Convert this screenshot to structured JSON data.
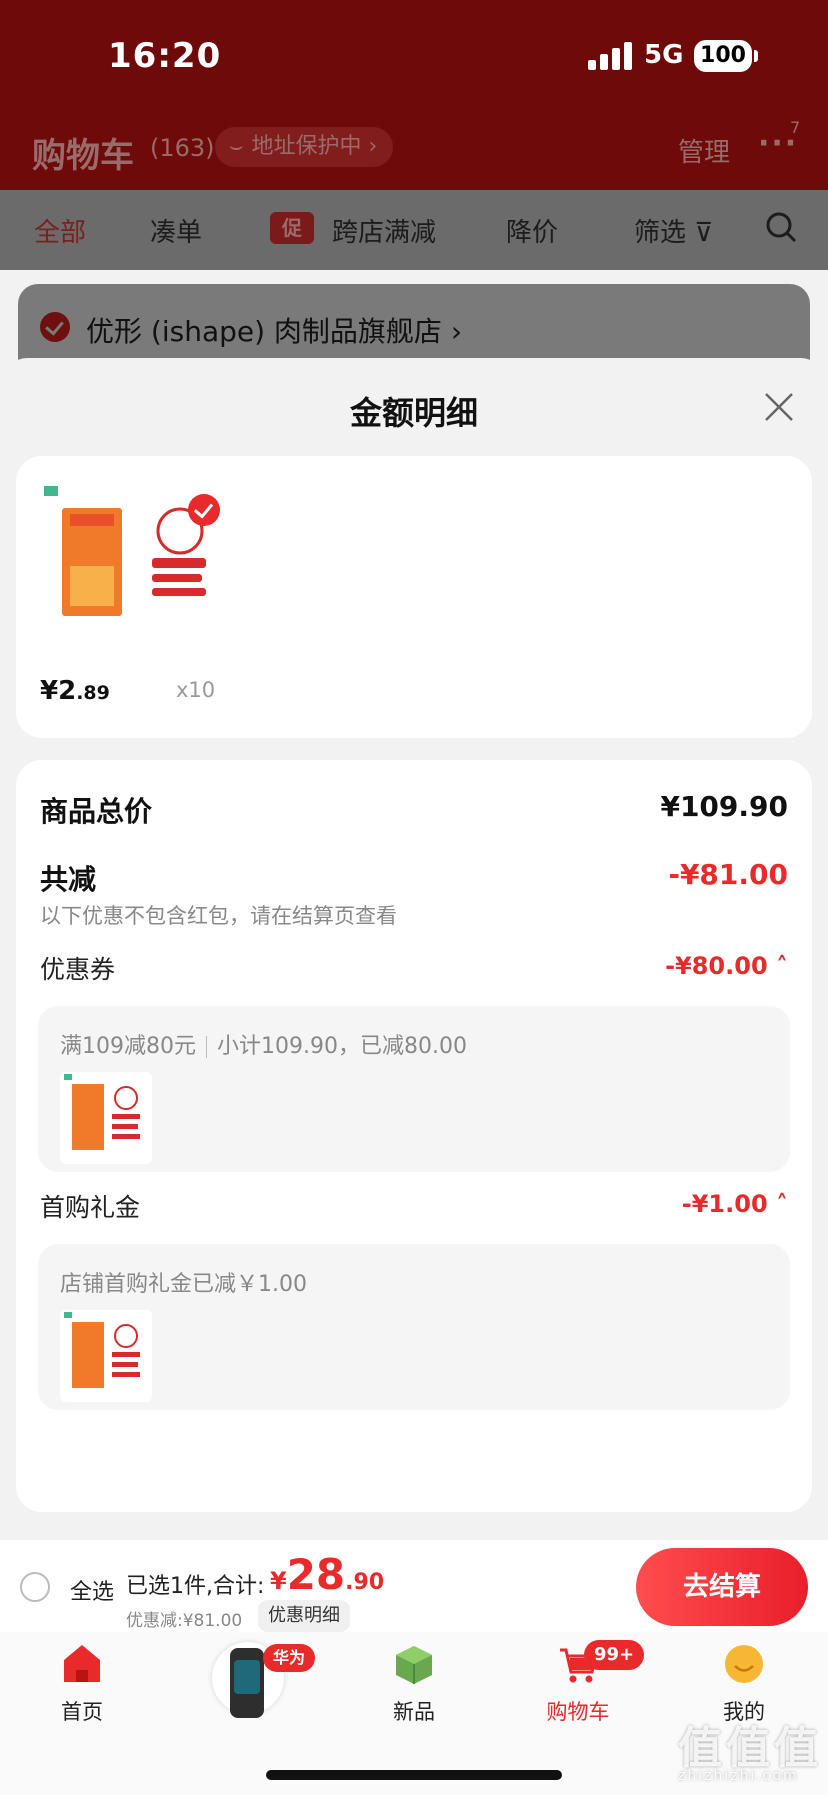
{
  "status_bar": {
    "time": "16:20",
    "network": "5G",
    "battery": "100"
  },
  "header": {
    "title": "购物车",
    "count": "(163)",
    "address_label": "地址保护中 ›",
    "manage": "管理",
    "more": "···",
    "more_badge": "7"
  },
  "filters": {
    "all": "全部",
    "combine": "凑单",
    "promo_tag": "促",
    "cross_store": "跨店满减",
    "price_drop": "降价",
    "filter": "筛选"
  },
  "shop": {
    "name": "优形 (ishape) 肉制品旗舰店 ›"
  },
  "sheet": {
    "title": "金额明细",
    "product": {
      "price_main": "¥2",
      "price_dec": ".89",
      "quantity": "x10"
    },
    "total_label": "商品总价",
    "total_value": "¥109.90",
    "discount_label": "共减",
    "discount_value": "-¥81.00",
    "discount_note": "以下优惠不包含红包，请在结算页查看",
    "coupon_label": "优惠券",
    "coupon_value": "-¥80.00 ˄",
    "coupon_desc": "满109减80元",
    "coupon_detail": "小计109.90，已减80.00",
    "gift_label": "首购礼金",
    "gift_value": "-¥1.00 ˄",
    "gift_desc": "店铺首购礼金已减￥1.00"
  },
  "checkout": {
    "select_all": "全选",
    "selected": "已选1件,合计:",
    "currency": "¥",
    "total_main": "28",
    "total_dec": ".90",
    "saved": "优惠减:¥81.00",
    "detail_btn": "优惠明细",
    "pay_btn": "去结算"
  },
  "tabbar": {
    "home": "首页",
    "brand_badge": "华为",
    "new": "新品",
    "cart": "购物车",
    "cart_badge": "99+",
    "me": "我的"
  },
  "watermark": {
    "main": "值值值",
    "sub": "zhizhizhi.com"
  },
  "colors": {
    "accent": "#e82a2a",
    "header_bg": "#6e0a0a"
  }
}
